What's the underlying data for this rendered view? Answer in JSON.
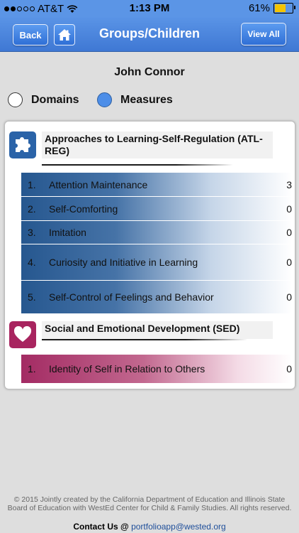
{
  "status_bar": {
    "carrier": "AT&T",
    "time": "1:13 PM",
    "battery": "61%",
    "battery_level": 0.61
  },
  "nav": {
    "back_label": "Back",
    "title": "Groups/Children",
    "view_all_label": "View All"
  },
  "child_name": "John Connor",
  "view_toggle": {
    "options": [
      {
        "label": "Domains",
        "selected": false
      },
      {
        "label": "Measures",
        "selected": true
      }
    ]
  },
  "domains": [
    {
      "title": "Approaches to Learning-Self-Regulation (ATL-REG)",
      "icon": "puzzle-icon",
      "color": "#2a63a8",
      "measures": [
        {
          "num": "1.",
          "name": "Attention Maintenance",
          "value": "3"
        },
        {
          "num": "2.",
          "name": "Self-Comforting",
          "value": "0"
        },
        {
          "num": "3.",
          "name": "Imitation",
          "value": "0"
        },
        {
          "num": "4.",
          "name": "Curiosity and Initiative in Learning",
          "value": "0"
        },
        {
          "num": "5.",
          "name": "Self-Control of Feelings and Behavior",
          "value": "0"
        }
      ]
    },
    {
      "title": "Social and Emotional Development (SED)",
      "icon": "heart-icon",
      "color": "#a8245f",
      "measures": [
        {
          "num": "1.",
          "name": "Identity of Self in Relation to Others",
          "value": "0"
        }
      ]
    }
  ],
  "footer": {
    "copyright": "© 2015 Jointly created by the California Department of Education and Illinois State Board of Education with WestEd Center for Child & Family Studies.  All rights reserved.",
    "contact_label": "Contact Us @",
    "contact_email": "portfolioapp@wested.org"
  }
}
